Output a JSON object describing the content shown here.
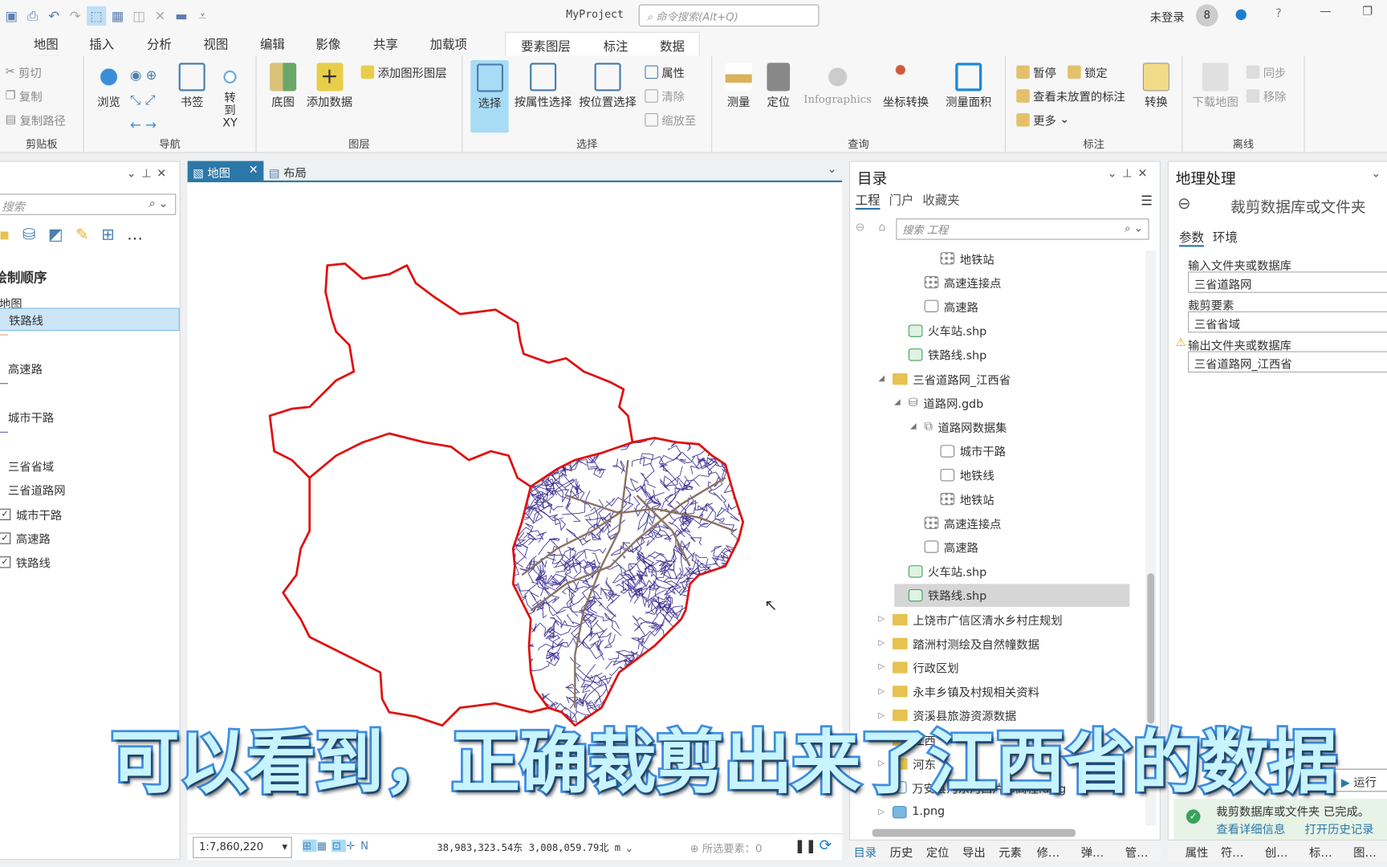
{
  "app": {
    "title": "MyProject",
    "command_search_placeholder": "命令搜索(Alt+Q)",
    "user": "未登录"
  },
  "ribbon_tabs": [
    "地图",
    "插入",
    "分析",
    "视图",
    "编辑",
    "影像",
    "共享",
    "加载项"
  ],
  "context_tabs": [
    "要素图层",
    "标注",
    "数据"
  ],
  "ribbon": {
    "clipboard": {
      "label": "剪贴板",
      "items": [
        "剪切",
        "复制",
        "复制路径"
      ]
    },
    "navigate": {
      "label": "导航",
      "items": [
        "浏览",
        "书签",
        "转到 XY"
      ]
    },
    "layer": {
      "label": "图层",
      "items": [
        "底图",
        "添加数据",
        "添加图形图层"
      ]
    },
    "selection": {
      "label": "选择",
      "items": [
        "选择",
        "按属性选择",
        "按位置选择",
        "属性",
        "清除",
        "缩放至"
      ]
    },
    "inquiry": {
      "label": "查询",
      "items": [
        "测量",
        "定位",
        "Infographics",
        "坐标转换",
        "测量面积"
      ]
    },
    "labeling": {
      "label": "标注",
      "items": [
        "暂停",
        "锁定",
        "查看未放置的标注",
        "更多",
        "转换"
      ]
    },
    "offline": {
      "label": "离线",
      "items": [
        "下载地图",
        "同步",
        "移除"
      ]
    }
  },
  "contents": {
    "search_placeholder": "搜索",
    "heading": "绘制顺序",
    "map": "地图",
    "layers": [
      {
        "name": "铁路线",
        "selected": true
      },
      {
        "name": "高速路"
      },
      {
        "name": "城市干路"
      },
      {
        "name": "三省省域"
      },
      {
        "name": "三省道路网"
      },
      {
        "name": "城市干路",
        "checked": true
      },
      {
        "name": "高速路",
        "checked": true
      },
      {
        "name": "铁路线",
        "checked": true
      }
    ]
  },
  "map_tabs": [
    {
      "label": "地图",
      "active": true
    },
    {
      "label": "布局"
    }
  ],
  "status": {
    "scale": "1:7,860,220",
    "coords": "38,983,323.54东 3,008,059.79北 m",
    "selected": "所选要素：0"
  },
  "catalog": {
    "title": "目录",
    "tabs": [
      "工程",
      "门户",
      "收藏夹"
    ],
    "search_placeholder": "搜索 工程",
    "items": [
      {
        "label": "地铁站",
        "level": 5,
        "icon": "point"
      },
      {
        "label": "高速连接点",
        "level": 4,
        "icon": "point"
      },
      {
        "label": "高速路",
        "level": 4,
        "icon": "line"
      },
      {
        "label": "火车站.shp",
        "level": 3,
        "icon": "shp-point"
      },
      {
        "label": "铁路线.shp",
        "level": 3,
        "icon": "shp-line"
      },
      {
        "label": "三省道路网_江西省",
        "level": 2,
        "icon": "folder",
        "expanded": true
      },
      {
        "label": "道路网.gdb",
        "level": 3,
        "icon": "gdb",
        "expanded": true
      },
      {
        "label": "道路网数据集",
        "level": 4,
        "icon": "dataset",
        "expanded": true
      },
      {
        "label": "城市干路",
        "level": 5,
        "icon": "line"
      },
      {
        "label": "地铁线",
        "level": 5,
        "icon": "line"
      },
      {
        "label": "地铁站",
        "level": 5,
        "icon": "point"
      },
      {
        "label": "高速连接点",
        "level": 4,
        "icon": "point"
      },
      {
        "label": "高速路",
        "level": 4,
        "icon": "line"
      },
      {
        "label": "火车站.shp",
        "level": 3,
        "icon": "shp-point"
      },
      {
        "label": "铁路线.shp",
        "level": 3,
        "icon": "shp-line",
        "selected": true
      },
      {
        "label": "上饶市广信区清水乡村庄规划",
        "level": 2,
        "icon": "folder",
        "expanded": false
      },
      {
        "label": "踏洲村测绘及自然幢数据",
        "level": 2,
        "icon": "folder",
        "expanded": false
      },
      {
        "label": "行政区划",
        "level": 2,
        "icon": "folder",
        "expanded": false
      },
      {
        "label": "永丰乡镇及村规相关资料",
        "level": 2,
        "icon": "folder",
        "expanded": false
      },
      {
        "label": "资溪县旅游资源数据",
        "level": 2,
        "icon": "folder",
        "expanded": false
      },
      {
        "label": "江西",
        "level": 2,
        "icon": "folder",
        "expanded": false
      },
      {
        "label": "河东",
        "level": 2,
        "icon": "folder",
        "expanded": false
      },
      {
        "label": "万安县河东河西片布高程.dwg",
        "level": 2,
        "icon": "cad",
        "expanded": false
      },
      {
        "label": "1.png",
        "level": 2,
        "icon": "raster",
        "expanded": false
      }
    ]
  },
  "bottom_tabs": [
    "目录",
    "历史",
    "定位",
    "导出",
    "元素",
    "修…",
    "弹…",
    "管…",
    "属性",
    "符…",
    "创…",
    "标…",
    "图…"
  ],
  "geoprocessing": {
    "title": "地理处理",
    "tool": "裁剪数据库或文件夹",
    "tabs": [
      "参数",
      "环境"
    ],
    "params": [
      {
        "label": "输入文件夹或数据库",
        "value": "三省道路网"
      },
      {
        "label": "裁剪要素",
        "value": "三省省域"
      },
      {
        "label": "输出文件夹或数据库",
        "value": "三省道路网_江西省",
        "warning": true
      }
    ],
    "run": "运行",
    "message": "裁剪数据库或文件夹 已完成。",
    "links": [
      "查看详细信息",
      "打开历史记录"
    ]
  },
  "subtitle": "可以看到，正确裁剪出来了江西省的数据",
  "colors": {
    "boundary": "#e01010",
    "roads": "#3a2d8f",
    "highways": "#8a7464",
    "accent": "#2b78a8"
  }
}
